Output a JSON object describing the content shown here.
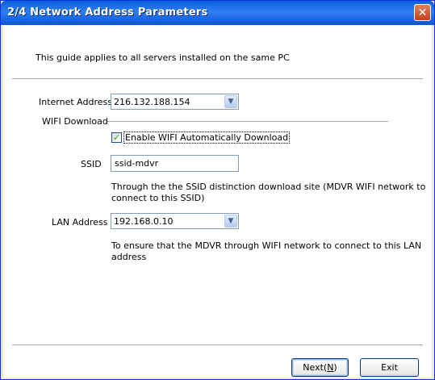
{
  "window": {
    "title": "2/4  Network Address Parameters",
    "close_label": "✕"
  },
  "intro": "This guide applies to all servers installed on the same PC",
  "internet_address": {
    "label": "Internet Address",
    "value": "216.132.188.154"
  },
  "wifi": {
    "group_label": "WIFI Download",
    "checkbox_label": "Enable WIFI Automatically Download",
    "checked": true,
    "ssid_label": "SSID",
    "ssid_value": "ssid-mdvr",
    "ssid_note_line1": "Through the the SSID distinction download site (MDVR WIFI network to",
    "ssid_note_line2": "connect to this SSID)"
  },
  "lan_address": {
    "label": "LAN Address",
    "value": "192.168.0.10",
    "note_line1": "To ensure that the MDVR through WIFI network to connect to this LAN",
    "note_line2": "address"
  },
  "buttons": {
    "next_pre": "Next(",
    "next_key": "N",
    "next_post": ")",
    "exit": "Exit"
  }
}
